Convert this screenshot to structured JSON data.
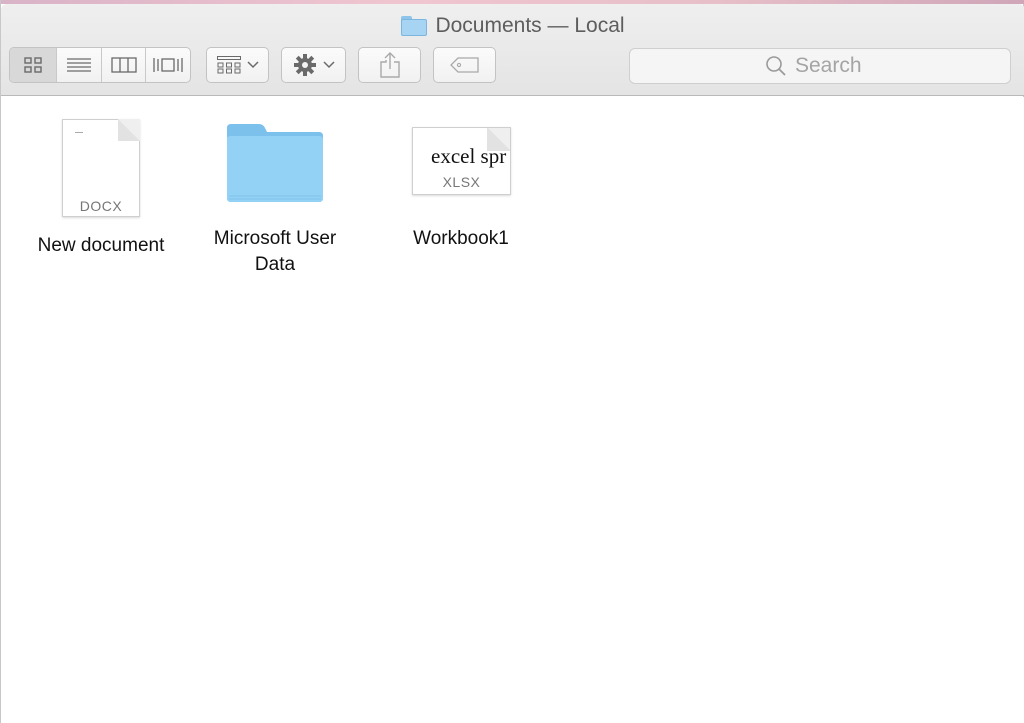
{
  "window": {
    "title": "Documents — Local"
  },
  "toolbar": {
    "view_modes": [
      {
        "name": "icon-view",
        "active": true
      },
      {
        "name": "list-view",
        "active": false
      },
      {
        "name": "column-view",
        "active": false
      },
      {
        "name": "cover-flow-view",
        "active": false
      }
    ],
    "arrange_icon": "grid-arrange-icon",
    "action_icon": "gear-icon",
    "share_icon": "share-icon",
    "tag_icon": "tag-icon"
  },
  "search": {
    "placeholder": "Search"
  },
  "files": [
    {
      "name": "New document",
      "kind": "docx",
      "badge": "DOCX"
    },
    {
      "name": "Microsoft User Data",
      "kind": "folder"
    },
    {
      "name": "Workbook1",
      "kind": "xlsx",
      "badge": "XLSX",
      "preview_text": "excel spr"
    }
  ],
  "colors": {
    "folder": "#8fcdf2",
    "folder_tab": "#7cc0ec",
    "titlebar": "#e8e8e8"
  }
}
